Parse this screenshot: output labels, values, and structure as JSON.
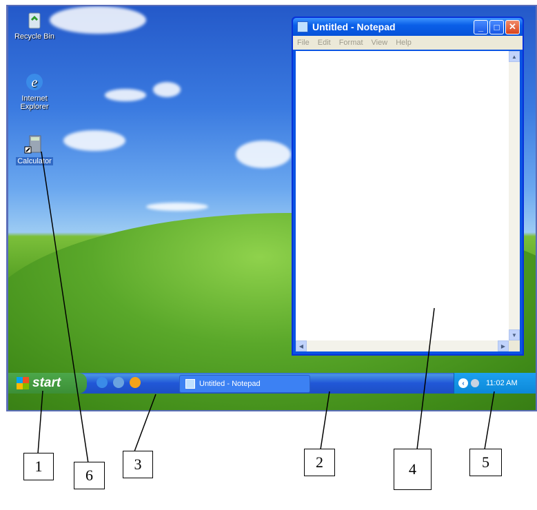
{
  "desktop": {
    "icons": [
      {
        "label": "Recycle Bin",
        "icon": "recycle-bin-icon",
        "selected": false
      },
      {
        "label": "Internet Explorer",
        "icon": "internet-explorer-icon",
        "selected": false
      },
      {
        "label": "Calculator",
        "icon": "calculator-icon",
        "selected": true
      }
    ]
  },
  "notepad": {
    "title": "Untitled - Notepad",
    "menu": [
      "File",
      "Edit",
      "Format",
      "View",
      "Help"
    ],
    "buttons": {
      "minimize": "_",
      "maximize": "□",
      "close": "✕"
    }
  },
  "taskbar": {
    "start_label": "start",
    "quick_launch": [
      "internet-explorer-icon",
      "outlook-express-icon",
      "media-player-icon"
    ],
    "task_label": "Untitled - Notepad",
    "clock": "11:02 AM"
  },
  "callouts": [
    "1",
    "6",
    "3",
    "2",
    "4",
    "5"
  ]
}
